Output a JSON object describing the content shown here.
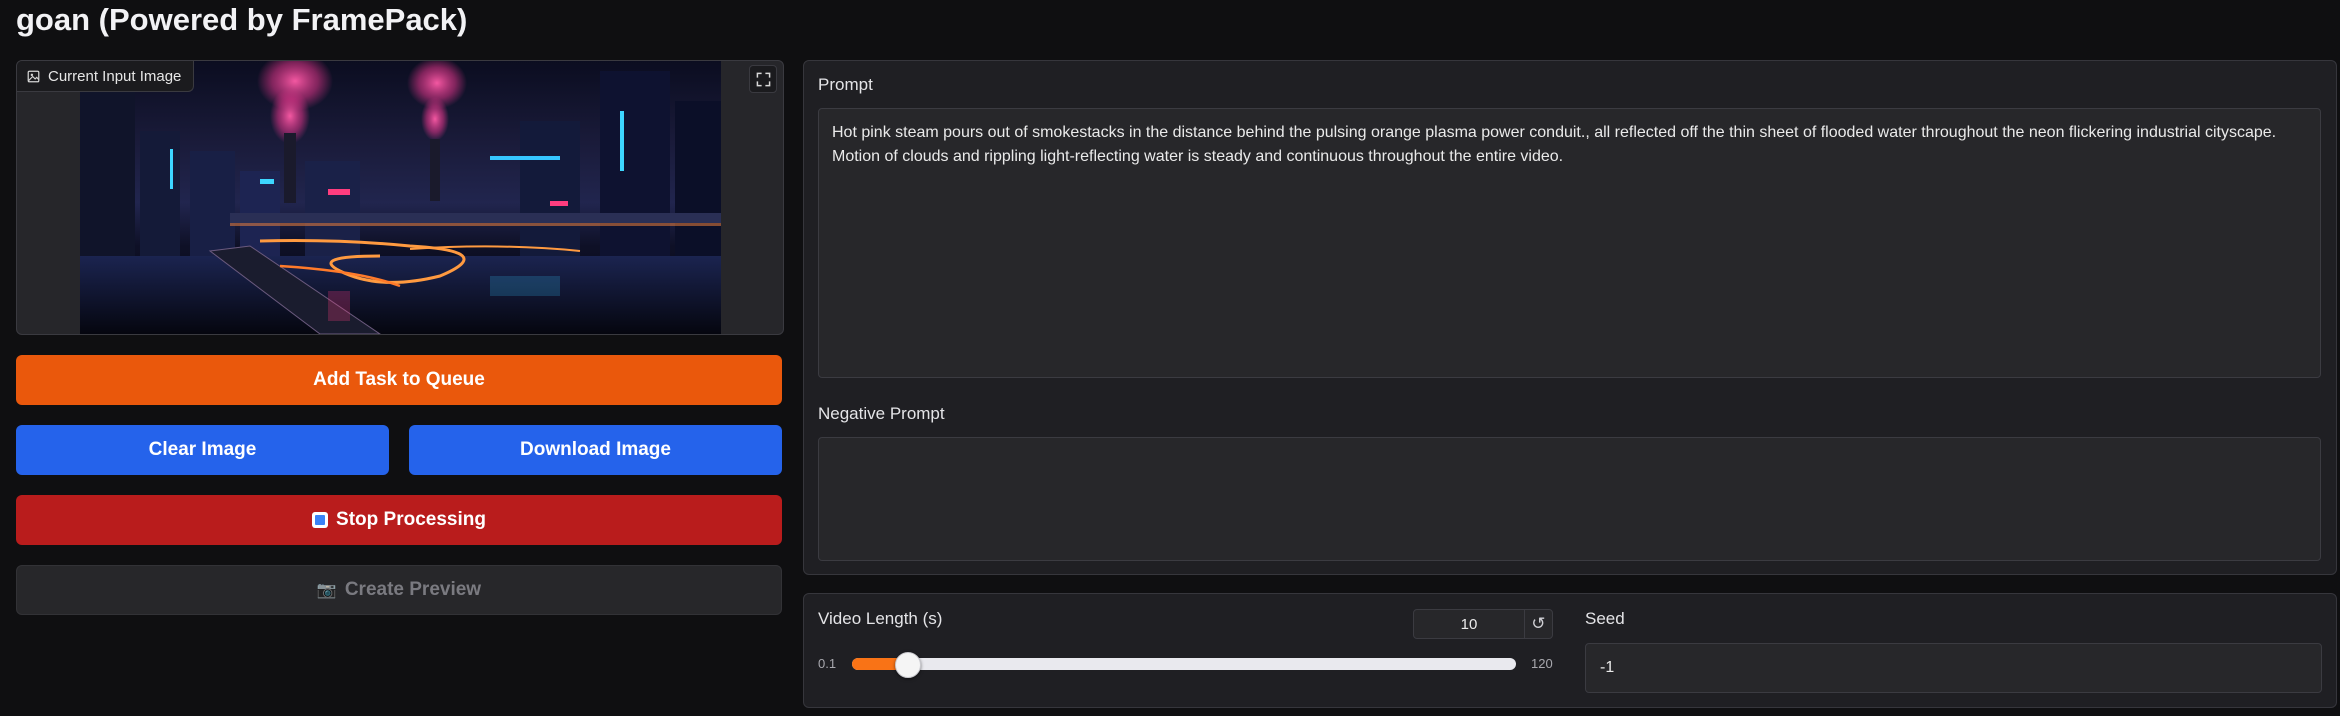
{
  "app": {
    "title": "goan (Powered by FramePack)"
  },
  "image_panel": {
    "label": "Current Input Image",
    "label_icon": "image-icon",
    "expand_icon": "fullscreen-icon"
  },
  "buttons": {
    "add_task": "Add Task to Queue",
    "clear_image": "Clear Image",
    "download_image": "Download Image",
    "stop_processing": "Stop Processing",
    "stop_icon": "stop-square-icon",
    "create_preview": "Create Preview",
    "preview_icon": "camera-icon"
  },
  "prompt": {
    "label": "Prompt",
    "value": "Hot pink steam pours out of smokestacks in the distance behind the pulsing orange plasma power conduit., all reflected off the thin sheet of flooded water throughout the neon flickering industrial cityscape. Motion of clouds and rippling light-reflecting water is steady and continuous throughout the entire video."
  },
  "negative_prompt": {
    "label": "Negative Prompt",
    "value": ""
  },
  "video_length": {
    "label": "Video Length (s)",
    "value": "10",
    "min": "0.1",
    "max": "120",
    "level": 10,
    "reset_icon": "reset-icon"
  },
  "seed": {
    "label": "Seed",
    "value": "-1"
  },
  "colors": {
    "orange": "#ea580c",
    "blue": "#2563eb",
    "red": "#b91c1c",
    "slider": "#f97316",
    "background": "#0f0f11"
  }
}
